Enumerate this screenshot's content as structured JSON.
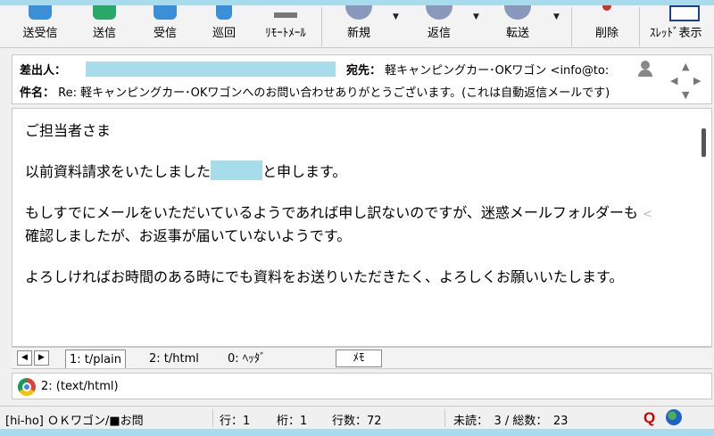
{
  "toolbar": {
    "items": [
      {
        "label": "送受信",
        "icon": "send-receive-icon",
        "color": "#3b8fd8"
      },
      {
        "label": "送信",
        "icon": "send-icon",
        "color": "#2aa86a"
      },
      {
        "label": "受信",
        "icon": "receive-icon",
        "color": "#3b8fd8"
      },
      {
        "label": "巡回",
        "icon": "patrol-icon",
        "color": "#3b8fd8"
      },
      {
        "label": "ﾘﾓｰﾄﾒｰﾙ",
        "icon": "remote-mail-icon",
        "color": "#777777"
      },
      {
        "label": "新規",
        "icon": "new-mail-icon",
        "color": "#8899bb"
      },
      {
        "label": "返信",
        "icon": "reply-icon",
        "color": "#8899bb"
      },
      {
        "label": "転送",
        "icon": "forward-icon",
        "color": "#8899bb"
      },
      {
        "label": "削除",
        "icon": "delete-icon",
        "color": "#cc3333"
      },
      {
        "label": "ｽﾚｯﾄﾞ表示",
        "icon": "thread-view-icon",
        "color": "#1e3f8c"
      }
    ]
  },
  "header": {
    "from_label": "差出人：",
    "to_label": "宛先：",
    "to_value": "軽キャンピングカー･OKワゴン <info@to:",
    "subject_label": "件名：",
    "subject_value": "Re: 軽キャンピングカー･OKワゴンへのお問い合わせありがとうございます。(これは自動返信メールです)"
  },
  "body": {
    "lines": [
      "ご担当者さま",
      "",
      "以前資料請求をいたしました",
      "と申します。",
      "",
      "もしすでにメールをいただいているようであれば申し訳ないのですが、迷惑メールフォルダーも",
      "確認しましたが、お返事が届いていないようです。",
      "",
      "よろしければお時間のある時にでも資料をお送りいただきたく、よろしくお願いいたします。"
    ],
    "clip_mark": "<"
  },
  "tabs": {
    "items": [
      "1: t/plain",
      "2: t/html",
      "0: ﾍｯﾀﾞ"
    ],
    "memo": "ﾒﾓ"
  },
  "attachment": {
    "label": "2: (text/html)"
  },
  "status": {
    "account": "[hi-ho] ＯＫワゴン/■お問",
    "line": "行：1",
    "col": "桁：1",
    "lines": "行数：72",
    "unread": "未読：　3 / 総数：　23"
  }
}
